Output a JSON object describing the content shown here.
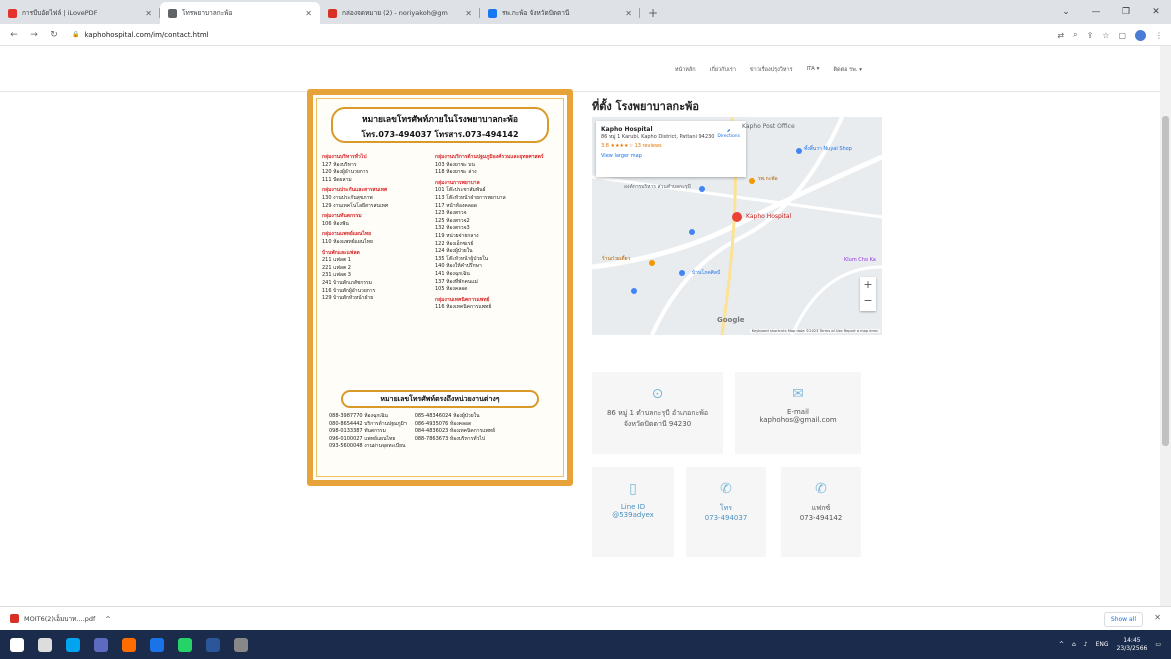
{
  "browser": {
    "tabs": [
      {
        "title": "การบีบอัดไฟล์ | iLovePDF",
        "favicon_color": "#e5322d",
        "active": false
      },
      {
        "title": "โทรพยาบาลกะพ้อ",
        "favicon_color": "#5f6368",
        "active": true
      },
      {
        "title": "กล่องจดหมาย (2) - noriyakoh@gm",
        "favicon_color": "#d93025",
        "active": false
      },
      {
        "title": "รพ.กะพ้อ จังหวัดปัตตานี",
        "favicon_color": "#1877f2",
        "active": false
      }
    ],
    "url": "kaphohospital.com/im/contact.html",
    "new_tab": "+",
    "window_controls": [
      "⌄",
      "—",
      "❐",
      "✕"
    ]
  },
  "site_nav": {
    "items": [
      "หน้าหลัก",
      "เกี่ยวกับเรา",
      "ข่าวเรื่องปรุงวิหาร",
      "ITA ▾",
      "ติดต่อ รพ. ▾"
    ]
  },
  "poster": {
    "title_line1": "หมายเลขโทรศัพท์ภายในโรงพยาบาลกะพ้อ",
    "title_line2": "โทร.073-494037  โทรสาร.073-494142",
    "left_column": [
      {
        "heading": "กลุ่มงานบริหารทั่วไป",
        "lines": [
          "127 ห้องบริหาร",
          "120 ห้องผู้อำนวยการ",
          "111 ปัดผลาม"
        ]
      },
      {
        "heading": "กลุ่มงานประกันและสารสนเทศ",
        "lines": [
          "130 งานประกันสุขภาพ",
          "129 งานเทคโนโลยีสารสนเทศ"
        ]
      },
      {
        "heading": "กลุ่มงานทันตกรรม",
        "lines": [
          "106 ห้องฟัน"
        ]
      },
      {
        "heading": "กลุ่มงานแพทย์แผนไทย",
        "lines": [
          "110 ห้องแพทย์แผนไทย"
        ]
      },
      {
        "heading": "บ้านพักและแฟลต",
        "lines": [
          "211 แฟลต 1",
          "221 แฟลต 2",
          "231 แฟลต 3",
          "241 บ้านพักเภสัชกรรม",
          "116 บ้านพักผู้อำนวยการ",
          "129 บ้านพักหัวหน้าฝ่าย"
        ]
      }
    ],
    "right_column": [
      {
        "heading": "กลุ่มงานบริการด้านปฐมภูมิองค์รวมและยุทธศาสตร์",
        "lines": [
          "103 ห้องยาชะ บน",
          "118 ห้องยาชะ ล่าง"
        ]
      },
      {
        "heading": "กลุ่มงานการพยาบาล",
        "lines": [
          "101 โต๊ะประชาสัมพันธ์",
          "113 โต๊ะหัวหน้าฝ่ายการพยาบาล",
          "117 หน้าห้องคลอด",
          "123 ห้องตรวจ",
          "125 ห้องตรวจ2",
          "132 ห้องตรวจ3",
          "119 หน่วยจ่ายกลาง",
          "122 ห้องเอ็กซเรย์",
          "124 ห้องผู้ป่วยใน",
          "135 โต๊ะหัวหน้าผู้ป่วยใน",
          "140 ห้องให้คำปรึกษา",
          "141 ห้องฉุกเฉิน",
          "137 ห้องที่พักคนแม่",
          "105 ห้องคลอด"
        ]
      },
      {
        "heading": "กลุ่มงานเทคนิคการแพทย์",
        "lines": [
          "116 ห้องเทคนิคการแพทย์"
        ]
      }
    ],
    "banner2": "หมายเลขโทรศัพท์ตรงถึงหน่วยงานต่างๆ",
    "direct_left": [
      "088-3987770  ห้องฉุกเฉิน",
      "080-8654442  บริการด้านปฐมภูมิฯ",
      "098-0133387  ทันตกรรม",
      "096-0100027  แพทย์แผนไทย",
      "093-5600048  งานผ่านจุดทะเบียน"
    ],
    "direct_right": [
      "085-48346024  ห้องผู้ป่วยใน",
      "086-4935076  ห้องคลอด",
      "084-4836023  ห้องเทคนิคการแพทย์",
      "088-7863673  ห้องบริหารทั่วไป"
    ]
  },
  "location": {
    "title": "ที่ตั้ง โรงพยาบาลกะพ้อ",
    "map": {
      "card_name": "Kapho Hospital",
      "card_address": "86 หมู่ 1 Karubi, Kapho District, Pattani 94230",
      "card_rating": "3.8 ★★★★☆  13 reviews",
      "card_link": "View larger map",
      "directions": "Directions",
      "labels": [
        "Kapho Post Office",
        "ทั้งสิ้นวา Nuyal Shop",
        "องค์การบริหาร ส่วนตำบลกะรุบี",
        "รพ.กะพ้อ",
        "Kapho Hospital",
        "ร้านก๋วยเตี๋ยว",
        "บ้านโภคศิลป์",
        "Klum Cho Ka"
      ],
      "google": "Google",
      "footer": "Keyboard shortcuts   Map data ©2023   Terms of Use   Report a map error"
    },
    "cards": [
      {
        "icon": "map-pin-icon",
        "glyph": "⊙",
        "line1": "86 หมู่ 1 ตำบลกะรุบี อำเภอกะพ้อ",
        "line2": "จังหวัดปัตตานี 94230"
      },
      {
        "icon": "mail-icon",
        "glyph": "✉",
        "line1": "E-mail",
        "line2": "kaphohos@gmail.com"
      },
      {
        "icon": "phone-icon",
        "glyph": "▯",
        "line1": "Line ID",
        "line2": "@539adyex"
      },
      {
        "icon": "phone-call-icon",
        "glyph": "✆",
        "line1": "โทร",
        "line2": "073-494037"
      },
      {
        "icon": "fax-icon",
        "glyph": "✆",
        "line1": "แฟกซ์",
        "line2": "073-494142"
      }
    ]
  },
  "download": {
    "file": "MOIT6(2)เอ็มบาท....pdf",
    "show_all": "Show all"
  },
  "taskbar": {
    "time": "14:45",
    "date": "23/3/2566",
    "lang": "ENG",
    "icon_colors": [
      "#ffffff",
      "#dddddd",
      "#00a4ef",
      "#5c6bc0",
      "#ff6d00",
      "#1a73e8",
      "#25d366",
      "#2b579a"
    ]
  }
}
